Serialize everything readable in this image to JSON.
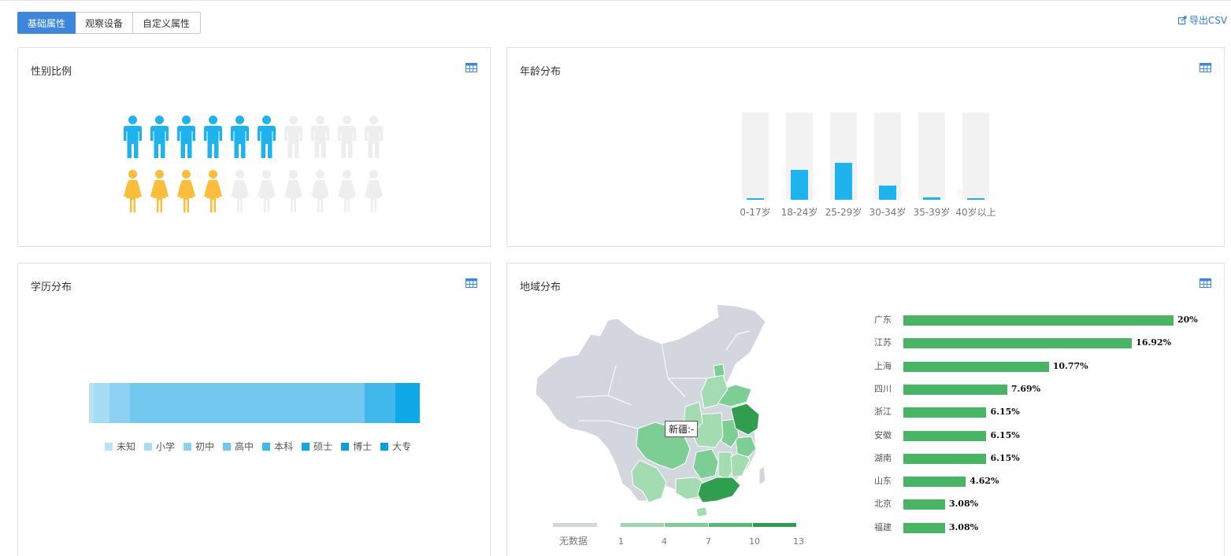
{
  "tabs": [
    {
      "label": "基础属性",
      "active": true
    },
    {
      "label": "观察设备",
      "active": false
    },
    {
      "label": "自定义属性",
      "active": false
    }
  ],
  "export_label": "导出CSV",
  "colors": {
    "accent": "#3d86de",
    "male": "#1eb3ef",
    "female": "#fbbd3a",
    "inactive": "#eeeeee",
    "bar": "#47b564"
  },
  "gender": {
    "title": "性别比例",
    "male_filled": 6,
    "female_filled": 4,
    "total_per_row": 10
  },
  "age": {
    "title": "年龄分布",
    "chart_data": {
      "type": "bar",
      "categories": [
        "0-17岁",
        "18-24岁",
        "25-29岁",
        "30-34岁",
        "35-39岁",
        "40岁以上"
      ],
      "values": [
        2,
        34,
        42,
        16,
        3,
        2
      ],
      "ylim": [
        0,
        100
      ]
    }
  },
  "education": {
    "title": "学历分布",
    "chart_data": {
      "type": "bar",
      "stacked_horizontal": true,
      "series": [
        {
          "name": "未知",
          "values": [
            1.4
          ],
          "color": "#b8e2f5"
        },
        {
          "name": "小学",
          "values": [
            4.8
          ],
          "color": "#a7dcf5"
        },
        {
          "name": "初中",
          "values": [
            6.2
          ],
          "color": "#8dd1f2"
        },
        {
          "name": "高中",
          "values": [
            71.0
          ],
          "color": "#72c8ef"
        },
        {
          "name": "本科",
          "values": [
            9.3
          ],
          "color": "#41b8ec"
        },
        {
          "name": "硕士",
          "values": [
            7.3
          ],
          "color": "#0ea9e6"
        },
        {
          "name": "博士",
          "values": [
            0
          ],
          "color": "#0b9ed8"
        },
        {
          "name": "大专",
          "values": [
            0
          ],
          "color": "#0aa2de"
        }
      ]
    }
  },
  "region": {
    "title": "地域分布",
    "tooltip": "新疆:-",
    "legend_nodata": "无数据",
    "legend_ticks": [
      "1",
      "4",
      "7",
      "10",
      "13"
    ],
    "chart_data": {
      "type": "bar",
      "categories": [
        "广东",
        "江苏",
        "上海",
        "四川",
        "浙江",
        "安徽",
        "湖南",
        "山东",
        "北京",
        "福建"
      ],
      "values": [
        20,
        16.92,
        10.77,
        7.69,
        6.15,
        6.15,
        6.15,
        4.62,
        3.08,
        3.08
      ],
      "labels": [
        "20%",
        "16.92%",
        "10.77%",
        "7.69%",
        "6.15%",
        "6.15%",
        "6.15%",
        "4.62%",
        "3.08%",
        "3.08%"
      ]
    }
  }
}
